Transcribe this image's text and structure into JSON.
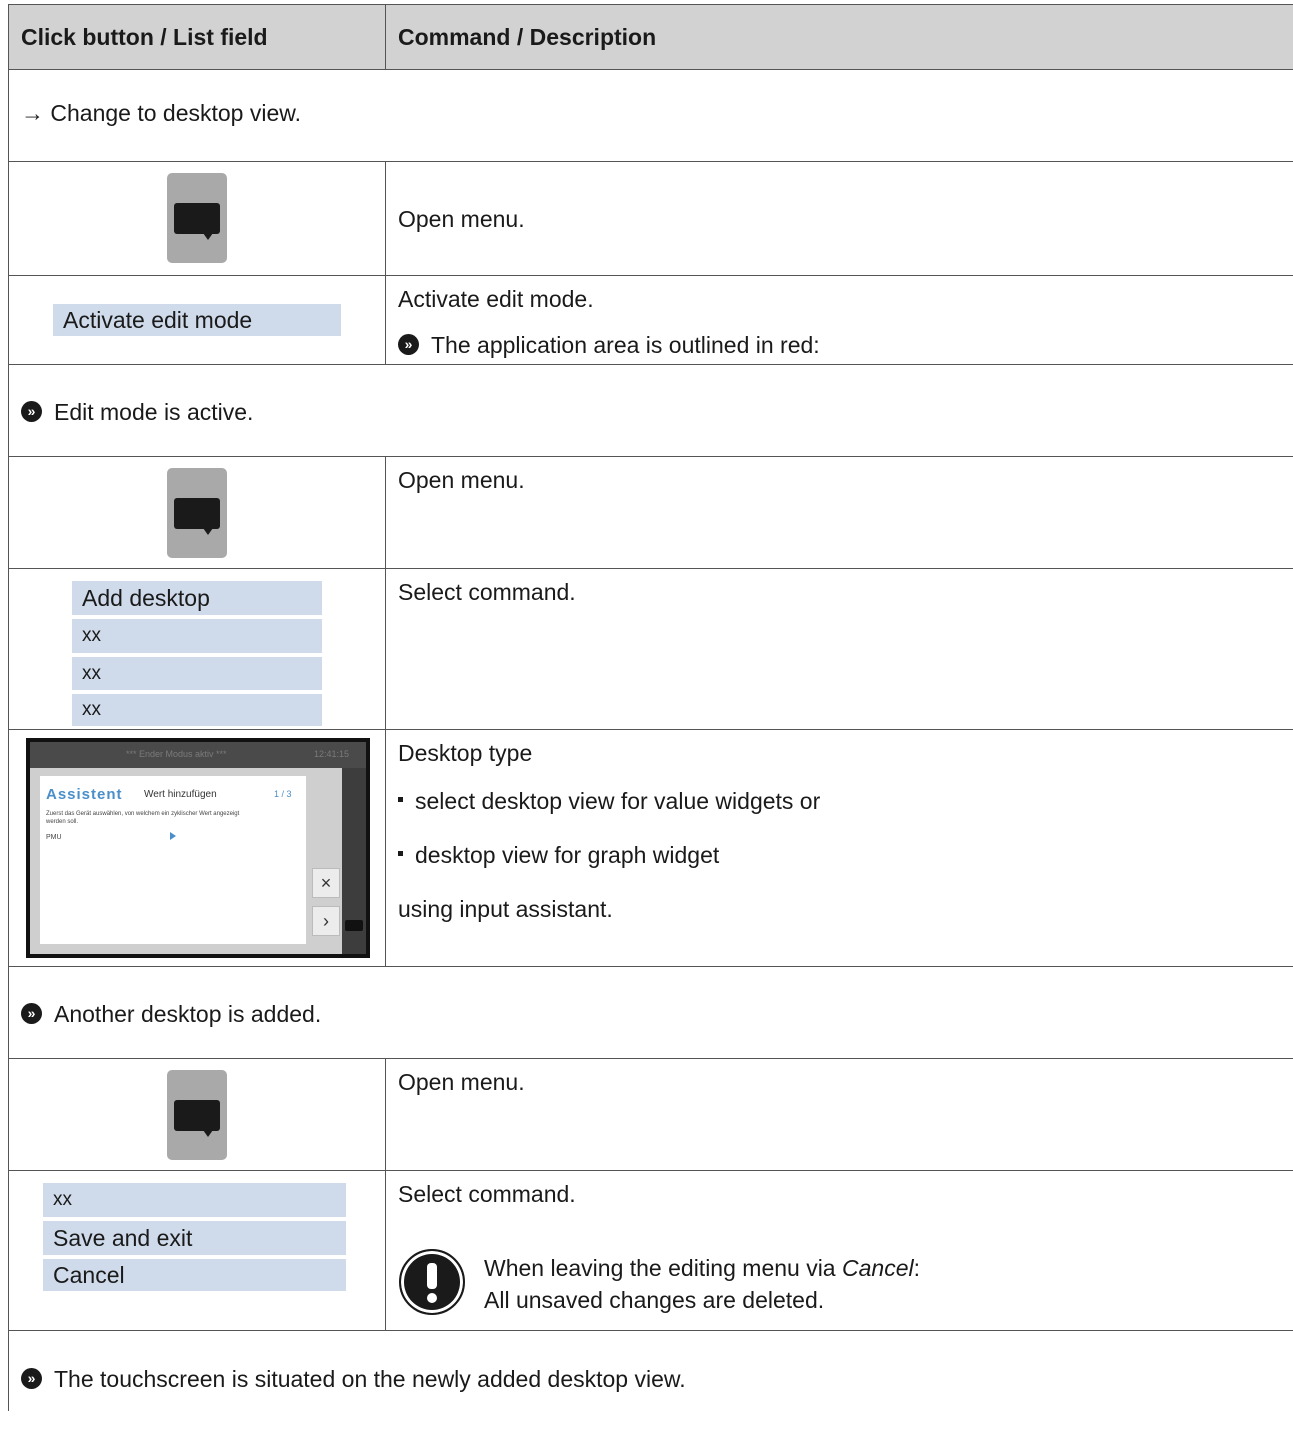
{
  "header": {
    "col1": "Click button / List field",
    "col2": "Command / Description"
  },
  "rows": {
    "change_desktop": "→ Change to desktop view.",
    "open_menu_1": "Open menu.",
    "activate_edit_field": "Activate edit mode",
    "activate_edit_desc": "Activate edit mode.",
    "activate_edit_result": "The application area is outlined in red:",
    "edit_mode_active": "Edit mode is active.",
    "open_menu_2": "Open menu.",
    "add_desktop_list": [
      "Add desktop",
      "xx",
      "xx",
      "xx"
    ],
    "select_command_1": "Select command.",
    "desktop_type_title": "Desktop type",
    "desktop_type_bullets": [
      "select desktop view for value widgets or",
      "desktop view for graph widget"
    ],
    "desktop_type_footer": "using input assistant.",
    "thumbnail": {
      "bar_text": "*** Ender Modus aktiv ***",
      "time": "12:41:15",
      "assistant": "Assistent",
      "step_title": "Wert hinzufügen",
      "step_count": "1 / 3",
      "instruction": "Zuerst das Gerät auswählen, von welchem ein zyklischer Wert angezeigt werden soll.",
      "device": "PMU",
      "close_icon": "×",
      "next_icon": "›"
    },
    "another_desktop": "Another desktop is added.",
    "open_menu_3": "Open menu.",
    "save_list": [
      "xx",
      "Save and exit",
      "Cancel"
    ],
    "select_command_2": "Select command.",
    "note_line1_prefix": "When leaving the editing menu via ",
    "note_line1_em": "Cancel",
    "note_line1_suffix": ":",
    "note_line2": "All unsaved changes are deleted.",
    "final_result": "The touchscreen is situated on the newly added desktop view."
  },
  "icons": {
    "menu_button": "speech-bubble-icon",
    "result_bullet": "double-chevron-circle-icon",
    "warning": "exclamation-circle-icon"
  },
  "colors": {
    "list_field_bg": "#cfdaea",
    "header_bg": "#d2d2d2",
    "menu_button_bg": "#a9a9a9"
  }
}
